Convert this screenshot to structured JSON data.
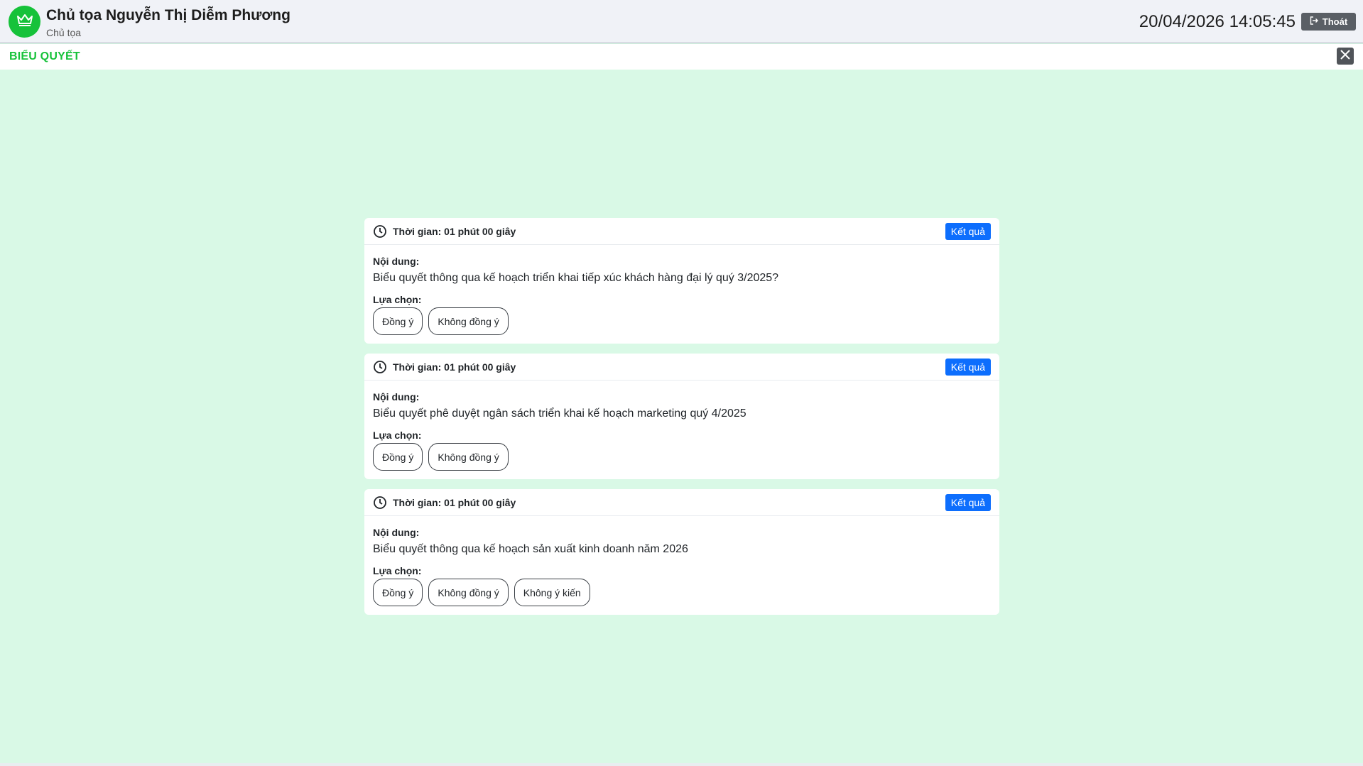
{
  "header": {
    "user_name": "Chủ tọa Nguyễn Thị Diễm Phương",
    "user_role": "Chủ tọa",
    "avatar_icon": "crown-icon",
    "datetime": "20/04/2026 14:05:45",
    "logout_label": "Thoát",
    "logout_icon": "logout-icon"
  },
  "page": {
    "title": "BIỂU QUYẾT",
    "close_icon": "close-icon"
  },
  "colors": {
    "brand_green": "#16c23a",
    "background": "#d9f9e6",
    "primary_blue": "#0d6efd"
  },
  "votes": [
    {
      "time_label": "Thời gian: 01 phút 00 giây",
      "result_label": "Kết quả",
      "content_label": "Nội dung:",
      "content": "Biểu quyết thông qua kế hoạch triển khai tiếp xúc khách hàng đại lý quý 3/2025?",
      "choices_label": "Lựa chọn:",
      "options": [
        "Đồng ý",
        "Không đồng ý"
      ]
    },
    {
      "time_label": "Thời gian: 01 phút 00 giây",
      "result_label": "Kết quả",
      "content_label": "Nội dung:",
      "content": "Biểu quyết phê duyệt ngân sách triển khai kế hoạch marketing quý 4/2025",
      "choices_label": "Lựa chọn:",
      "options": [
        "Đồng ý",
        "Không đồng ý"
      ]
    },
    {
      "time_label": "Thời gian: 01 phút 00 giây",
      "result_label": "Kết quả",
      "content_label": "Nội dung:",
      "content": "Biểu quyết thông qua kế hoạch sản xuất kinh doanh năm 2026",
      "choices_label": "Lựa chọn:",
      "options": [
        "Đồng ý",
        "Không đồng ý",
        "Không ý kiến"
      ]
    }
  ]
}
